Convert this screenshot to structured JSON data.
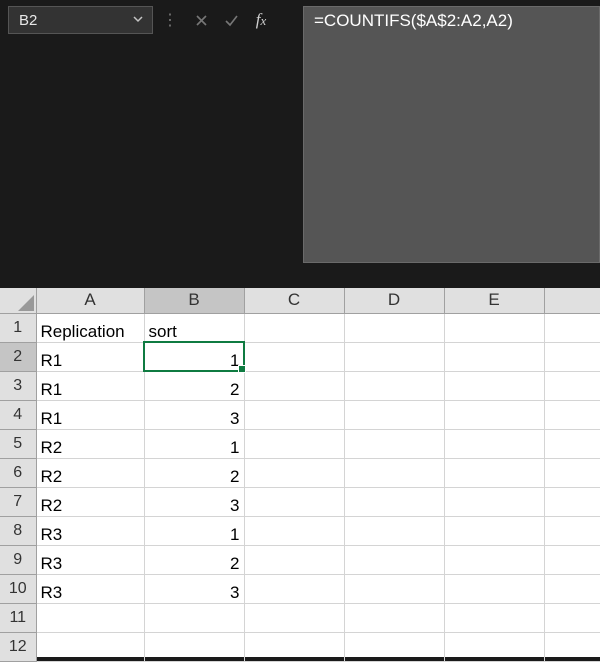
{
  "nameBox": {
    "value": "B2"
  },
  "formulaBar": {
    "value": "=COUNTIFS($A$2:A2,A2)"
  },
  "columns": [
    "A",
    "B",
    "C",
    "D",
    "E",
    ""
  ],
  "activeColIndex": 1,
  "activeRowIndex": 1,
  "rows": [
    {
      "num": "1",
      "cells": [
        "Replication",
        "sort",
        "",
        "",
        "",
        ""
      ],
      "numCols": []
    },
    {
      "num": "2",
      "cells": [
        "R1",
        "1",
        "",
        "",
        "",
        ""
      ],
      "numCols": [
        1
      ]
    },
    {
      "num": "3",
      "cells": [
        "R1",
        "2",
        "",
        "",
        "",
        ""
      ],
      "numCols": [
        1
      ]
    },
    {
      "num": "4",
      "cells": [
        "R1",
        "3",
        "",
        "",
        "",
        ""
      ],
      "numCols": [
        1
      ]
    },
    {
      "num": "5",
      "cells": [
        "R2",
        "1",
        "",
        "",
        "",
        ""
      ],
      "numCols": [
        1
      ]
    },
    {
      "num": "6",
      "cells": [
        "R2",
        "2",
        "",
        "",
        "",
        ""
      ],
      "numCols": [
        1
      ]
    },
    {
      "num": "7",
      "cells": [
        "R2",
        "3",
        "",
        "",
        "",
        ""
      ],
      "numCols": [
        1
      ]
    },
    {
      "num": "8",
      "cells": [
        "R3",
        "1",
        "",
        "",
        "",
        ""
      ],
      "numCols": [
        1
      ]
    },
    {
      "num": "9",
      "cells": [
        "R3",
        "2",
        "",
        "",
        "",
        ""
      ],
      "numCols": [
        1
      ]
    },
    {
      "num": "10",
      "cells": [
        "R3",
        "3",
        "",
        "",
        "",
        ""
      ],
      "numCols": [
        1
      ]
    },
    {
      "num": "11",
      "cells": [
        "",
        "",
        "",
        "",
        "",
        ""
      ],
      "numCols": []
    },
    {
      "num": "12",
      "cells": [
        "",
        "",
        "",
        "",
        "",
        ""
      ],
      "numCols": []
    }
  ]
}
